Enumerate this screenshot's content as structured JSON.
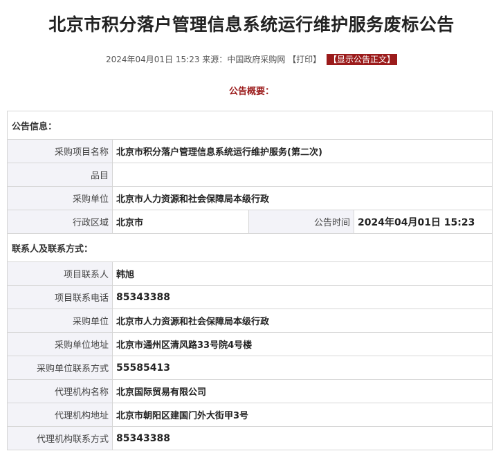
{
  "title": "北京市积分落户管理信息系统运行维护服务废标公告",
  "meta": {
    "datetime": "2024年04月01日 15:23",
    "source_label": "来源：",
    "source": "中国政府采购网",
    "print_label": "【打印】",
    "show_text_label": "【显示公告正文】"
  },
  "summary_heading": "公告概要：",
  "notice_info": {
    "section_title": "公告信息：",
    "project_name_label": "采购项目名称",
    "project_name": "北京市积分落户管理信息系统运行维护服务(第二次)",
    "item_label": "品目",
    "item": "",
    "purchaser_label": "采购单位",
    "purchaser": "北京市人力资源和社会保障局本级行政",
    "region_label": "行政区域",
    "region": "北京市",
    "publish_time_label": "公告时间",
    "publish_time": "2024年04月01日 15:23"
  },
  "contacts": {
    "section_title": "联系人及联系方式：",
    "rows": [
      {
        "label": "项目联系人",
        "value": "韩旭"
      },
      {
        "label": "项目联系电话",
        "value": "85343388"
      },
      {
        "label": "采购单位",
        "value": "北京市人力资源和社会保障局本级行政"
      },
      {
        "label": "采购单位地址",
        "value": "北京市通州区清风路33号院4号楼"
      },
      {
        "label": "采购单位联系方式",
        "value": "55585413"
      },
      {
        "label": "代理机构名称",
        "value": "北京国际贸易有限公司"
      },
      {
        "label": "代理机构地址",
        "value": "北京市朝阳区建国门外大街甲3号"
      },
      {
        "label": "代理机构联系方式",
        "value": "85343388"
      }
    ]
  },
  "colors": {
    "accent": "#9b1b1b",
    "label_bg": "#f3f3f8",
    "border": "#d6d6d6"
  }
}
